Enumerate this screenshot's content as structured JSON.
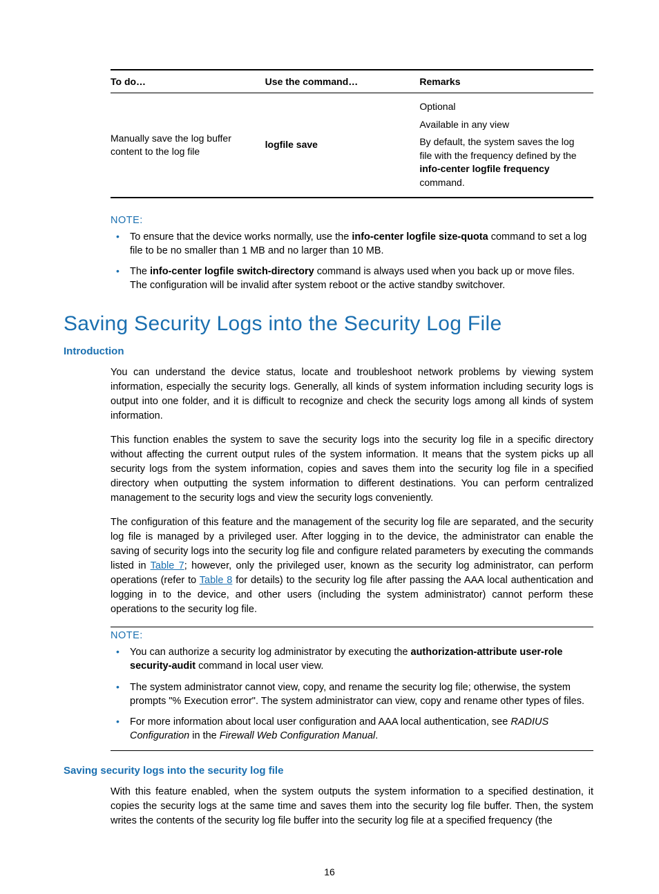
{
  "table": {
    "headers": [
      "To do…",
      "Use the command…",
      "Remarks"
    ],
    "row": {
      "todo": "Manually save the log buffer content to the log file",
      "command": "logfile save",
      "remarks_line1": "Optional",
      "remarks_line2": "Available in any view",
      "remarks_line3_pre": "By default, the system saves the log file with the frequency defined by the ",
      "remarks_cmd": "info-center logfile frequency",
      "remarks_line3_post": " command."
    }
  },
  "note1": {
    "label": "NOTE:",
    "items": [
      {
        "pre": "To ensure that the device works normally, use the ",
        "bold": "info-center logfile size-quota",
        "post": " command to set a log file to be no smaller than 1 MB and no larger than 10 MB."
      },
      {
        "pre": "The ",
        "bold": "info-center logfile switch-directory",
        "post": " command is always used when you back up or move files. The configuration will be invalid after system reboot or the active standby switchover."
      }
    ]
  },
  "section": {
    "title": "Saving Security Logs into the Security Log File",
    "intro_heading": "Introduction",
    "p1": "You can understand the device status, locate and troubleshoot network problems by viewing system information, especially the security logs. Generally, all kinds of system information including security logs is output into one folder, and it is difficult to recognize and check the security logs among all kinds of system information.",
    "p2": "This function enables the system to save the security logs into the security log file in a specific directory without affecting the current output rules of the system information. It means that the system picks up all security logs from the system information, copies and saves them into the security log file in a specified directory when outputting the system information to different destinations. You can perform centralized management to the security logs and view the security logs conveniently.",
    "p3_a": "The configuration of this feature and the management of the security log file are separated, and the security log file is managed by a privileged user. After logging in to the device, the administrator can enable the saving of security logs into the security log file and configure related parameters by executing the commands listed in ",
    "p3_link1": "Table 7",
    "p3_b": "; however, only the privileged user, known as the security log administrator, can perform operations (refer to ",
    "p3_link2": "Table 8",
    "p3_c": " for details) to the security log file after passing the AAA local authentication and logging in to the device, and other users (including the system administrator) cannot perform these operations to the security log file."
  },
  "note2": {
    "label": "NOTE:",
    "items": [
      {
        "pre": "You can authorize a security log administrator by executing the ",
        "bold": "authorization-attribute user-role security-audit",
        "post": " command in local user view."
      },
      {
        "pre": "The system administrator cannot view, copy, and rename the security log file; otherwise, the system prompts \"% Execution error\". The system administrator can view, copy and rename other types of files.",
        "bold": "",
        "post": ""
      },
      {
        "pre": "For more information about local user configuration and AAA local authentication, see ",
        "italic1": "RADIUS Configuration",
        "mid": " in the ",
        "italic2": "Firewall Web Configuration Manual",
        "post": "."
      }
    ]
  },
  "section2": {
    "heading": "Saving security logs into the security log file",
    "p1": "With this feature enabled, when the system outputs the system information to a specified destination, it copies the security logs at the same time and saves them into the security log file buffer. Then, the system writes the contents of the security log file buffer into the security log file at a specified frequency (the"
  },
  "pagenum": "16"
}
